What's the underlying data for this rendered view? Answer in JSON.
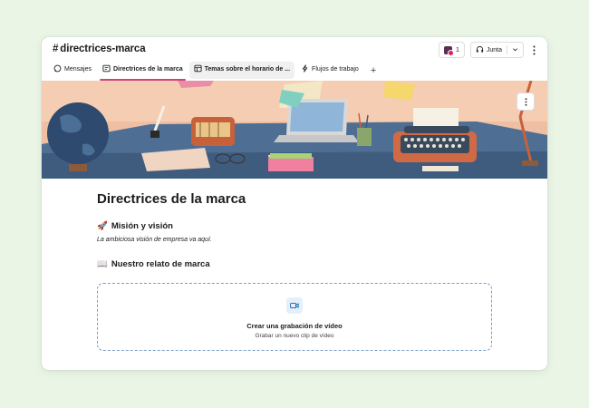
{
  "channel": {
    "hash": "#",
    "name": "directrices-marca"
  },
  "header": {
    "member_count": "1",
    "huddle_label": "Junta",
    "icons": [
      "avatar",
      "headphones-icon",
      "chevron-down-icon",
      "kebab-icon"
    ]
  },
  "tabs": [
    {
      "label": "Mensajes",
      "icon": "chat-bubble-icon"
    },
    {
      "label": "Directrices de la marca",
      "icon": "canvas-icon"
    },
    {
      "label": "Temas sobre el horario de ...",
      "icon": "canvas-list-icon"
    },
    {
      "label": "Flujos de trabajo",
      "icon": "lightning-icon"
    }
  ],
  "document": {
    "title": "Directrices de la marca",
    "section1_emoji": "🚀",
    "section1_title": "Misión y visión",
    "section1_text": "La ambiciosa visión de empresa va aquí.",
    "section2_emoji": "📖",
    "section2_title": "Nuestro relato de marca"
  },
  "video_card": {
    "title": "Crear una grabación de vídeo",
    "subtitle": "Grabar un nuevo clip de vídeo"
  },
  "colors": {
    "accent": "#d1437e",
    "background": "#eaf5e6",
    "dashed": "#7a9fc9"
  }
}
